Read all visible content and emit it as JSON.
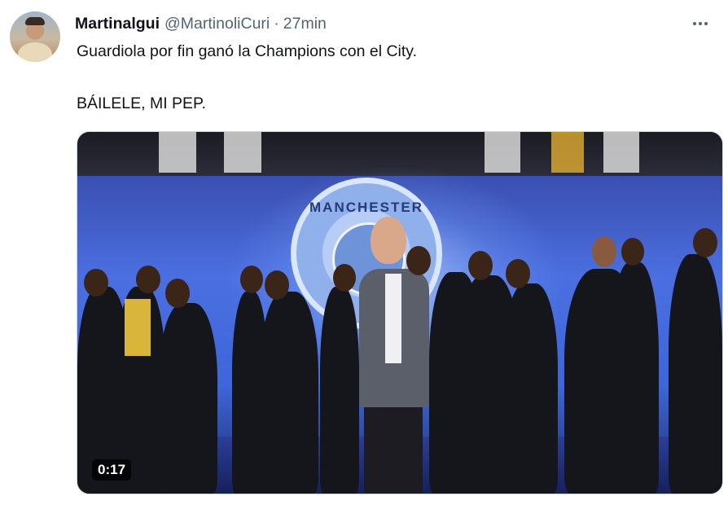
{
  "tweet": {
    "author_name": "Martinalgui",
    "handle": "@MartinoliCuri",
    "separator": "·",
    "time_ago": "27min",
    "more_icon": "more-horizontal-icon",
    "text_line1": "Guardiola por fin ganó la Champions con el City.",
    "text_line2": "BÁILELE, MI PEP."
  },
  "media": {
    "type": "video",
    "duration": "0:17",
    "crest_text": "MANCHESTER"
  },
  "colors": {
    "text_primary": "#0f1419",
    "text_secondary": "#536471",
    "media_border": "#cfd9de"
  }
}
